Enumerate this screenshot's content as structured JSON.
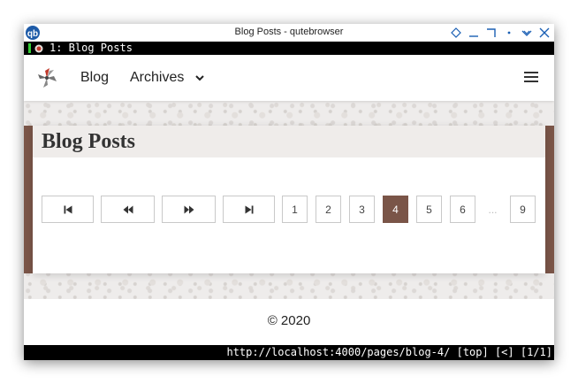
{
  "window": {
    "title": "Blog Posts - qutebrowser"
  },
  "tabs": [
    {
      "label": "1: Blog Posts"
    }
  ],
  "navbar": {
    "blog_label": "Blog",
    "archives_label": "Archives"
  },
  "page": {
    "title": "Blog Posts"
  },
  "pagination": {
    "pages": [
      "1",
      "2",
      "3",
      "4",
      "5",
      "6",
      "...",
      "9"
    ],
    "current": "4"
  },
  "footer": {
    "copyright": "© 2020"
  },
  "statusbar": {
    "url": "http://localhost:4000/pages/blog-4/",
    "scroll": "[top]",
    "history": "[<]",
    "tab_index": "[1/1]"
  },
  "colors": {
    "accent": "#7a5548",
    "tab_indicator": "#33cc33"
  },
  "icons": {
    "first": "skip-first-icon",
    "prev": "rewind-icon",
    "next": "fast-forward-icon",
    "last": "skip-last-icon"
  }
}
